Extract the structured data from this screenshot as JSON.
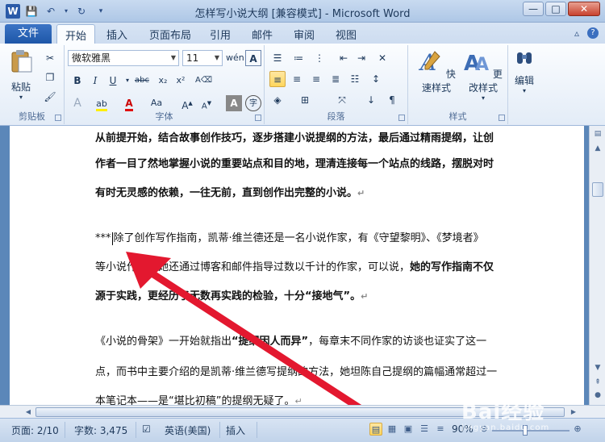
{
  "window": {
    "title": "怎样写小说大纲 [兼容模式] - Microsoft Word",
    "app_icon": "W"
  },
  "tabs": [
    "文件",
    "开始",
    "插入",
    "页面布局",
    "引用",
    "邮件",
    "审阅",
    "视图"
  ],
  "active_tab": "开始",
  "ribbon": {
    "clipboard": {
      "label": "剪贴板",
      "paste": "粘贴"
    },
    "font": {
      "label": "字体",
      "font_name": "微软雅黑",
      "font_size": "11"
    },
    "paragraph": {
      "label": "段落"
    },
    "styles": {
      "label": "样式",
      "quick_styles": "快速样式",
      "change_styles": "更改样式"
    },
    "editing": {
      "label": "编辑",
      "edit": "编辑"
    }
  },
  "document": {
    "paragraphs": [
      {
        "text": "从前提开始，结合故事创作技巧，逐步搭建小说提纲的方法，最后通过精雨提纲，让创",
        "bold": true
      },
      {
        "text": "作者一目了然地掌握小说的重要站点和目的地，理清连接每一个站点的线路，摆脱对时",
        "bold": true
      },
      {
        "text": "有时无灵感的依赖，一往无前，直到创作出完整的小说。",
        "bold": true,
        "mark": "↵"
      },
      {
        "prefix": "***",
        "text": "除了创作写作指南，凯蒂·维兰德还是一名小说作家，有《守望黎明》、《梦境者》"
      },
      {
        "text_a": "等小说作品，她还通过博客和邮件指导过数以千计的作家，可以说，",
        "text_b": "她的写作指南不仅"
      },
      {
        "text": "源于实践，更经历了无数再实践的检验，十分“接地气”。",
        "bold": true,
        "mark": "↵"
      },
      {
        "text_a": "《小说的骨架》一开始就指出",
        "text_b": "“提纲因人而异”",
        "text_c": "，每章末不同作家的访谈也证实了这一"
      },
      {
        "text": "点，而书中主要介绍的是凯蒂·维兰德写提纲的方法，她坦陈自己提纲的篇幅通常超过一"
      },
      {
        "text": "本笔记本——是“堪比初稿”的提纲无疑了。",
        "mark": "↵"
      }
    ]
  },
  "status": {
    "page": "页面: 2/10",
    "words": "字数: 3,475",
    "language": "英语(美国)",
    "mode": "插入",
    "zoom": "90%"
  },
  "watermark": {
    "brand": "Bai经验",
    "sub": "jingyan.baidu.com"
  },
  "colors": {
    "file_tab": "#2a62b5",
    "doc_bg": "#5b87b9",
    "arrow": "#e3182f"
  }
}
